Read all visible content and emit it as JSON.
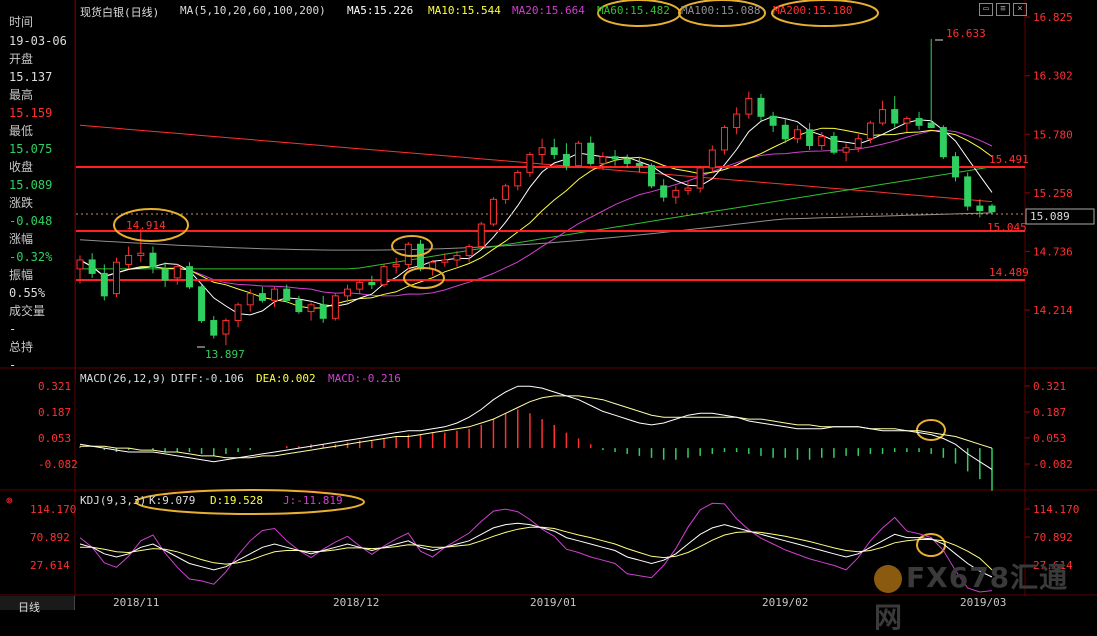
{
  "sidebar": {
    "time_label": "时间",
    "time_value": "19-03-06",
    "open_label": "开盘",
    "open_value": "15.137",
    "high_label": "最高",
    "high_value": "15.159",
    "low_label": "最低",
    "low_value": "15.075",
    "close_label": "收盘",
    "close_value": "15.089",
    "change_label": "涨跌",
    "change_value": "-0.048",
    "pct_label": "涨幅",
    "pct_value": "-0.32%",
    "amp_label": "振幅",
    "amp_value": "0.55%",
    "vol_label": "成交量",
    "vol_value": "-",
    "oi_label": "总持",
    "oi_value": "-"
  },
  "header": {
    "title": "现货白银(日线)",
    "ma_params": "MA(5,10,20,60,100,200)",
    "ma5": "MA5:15.226",
    "ma10": "MA10:15.544",
    "ma20": "MA20:15.664",
    "ma60": "MA60:15.482",
    "ma100": "MA100:15.088",
    "ma200": "MA200:15.180"
  },
  "macd_header": {
    "params": "MACD(26,12,9)",
    "diff": "DIFF:-0.106",
    "dea": "DEA:0.002",
    "macd": "MACD:-0.216"
  },
  "kdj_header": {
    "params": "KDJ(9,3,3)",
    "k": "K:9.079",
    "d": "D:19.528",
    "j": "J:-11.819"
  },
  "footer": {
    "period_tab": "日线",
    "dates": [
      "2018/11",
      "2018/12",
      "2019/01",
      "2019/02",
      "2019/03"
    ]
  },
  "watermark": "FX678汇通网",
  "colors": {
    "up": "#ff3030",
    "down": "#30d060",
    "ma5": "#ffffff",
    "ma10": "#ffff40",
    "ma20": "#d040d0",
    "ma60": "#30c030",
    "ma100": "#909090",
    "ma200": "#ff3030",
    "hline": "#ff2020",
    "circle": "#e8b030"
  },
  "chart_data": {
    "type": "candlestick",
    "price_axis": {
      "ticks": [
        "16.825",
        "16.302",
        "15.780",
        "15.258",
        "14.736",
        "14.214"
      ]
    },
    "current_price": "15.089",
    "annotations": {
      "high": "16.633",
      "low": "13.897",
      "levels": [
        "15.491",
        "14.914",
        "15.045",
        "14.489"
      ]
    },
    "candles": [
      {
        "o": 14.58,
        "h": 14.7,
        "l": 14.45,
        "c": 14.66
      },
      {
        "o": 14.66,
        "h": 14.72,
        "l": 14.5,
        "c": 14.54
      },
      {
        "o": 14.54,
        "h": 14.62,
        "l": 14.3,
        "c": 14.34
      },
      {
        "o": 14.36,
        "h": 14.68,
        "l": 14.33,
        "c": 14.64
      },
      {
        "o": 14.62,
        "h": 14.78,
        "l": 14.58,
        "c": 14.7
      },
      {
        "o": 14.7,
        "h": 14.94,
        "l": 14.64,
        "c": 14.72
      },
      {
        "o": 14.72,
        "h": 14.78,
        "l": 14.54,
        "c": 14.6
      },
      {
        "o": 14.58,
        "h": 14.64,
        "l": 14.42,
        "c": 14.48
      },
      {
        "o": 14.5,
        "h": 14.62,
        "l": 14.44,
        "c": 14.6
      },
      {
        "o": 14.6,
        "h": 14.64,
        "l": 14.4,
        "c": 14.42
      },
      {
        "o": 14.42,
        "h": 14.44,
        "l": 14.1,
        "c": 14.12
      },
      {
        "o": 14.12,
        "h": 14.16,
        "l": 13.96,
        "c": 13.99
      },
      {
        "o": 14.0,
        "h": 14.14,
        "l": 13.9,
        "c": 14.12
      },
      {
        "o": 14.12,
        "h": 14.28,
        "l": 14.06,
        "c": 14.26
      },
      {
        "o": 14.26,
        "h": 14.4,
        "l": 14.2,
        "c": 14.36
      },
      {
        "o": 14.36,
        "h": 14.42,
        "l": 14.28,
        "c": 14.3
      },
      {
        "o": 14.3,
        "h": 14.42,
        "l": 14.24,
        "c": 14.4
      },
      {
        "o": 14.4,
        "h": 14.44,
        "l": 14.28,
        "c": 14.3
      },
      {
        "o": 14.3,
        "h": 14.34,
        "l": 14.18,
        "c": 14.2
      },
      {
        "o": 14.2,
        "h": 14.28,
        "l": 14.12,
        "c": 14.26
      },
      {
        "o": 14.26,
        "h": 14.34,
        "l": 14.1,
        "c": 14.14
      },
      {
        "o": 14.14,
        "h": 14.36,
        "l": 14.12,
        "c": 14.34
      },
      {
        "o": 14.34,
        "h": 14.44,
        "l": 14.28,
        "c": 14.4
      },
      {
        "o": 14.4,
        "h": 14.48,
        "l": 14.36,
        "c": 14.46
      },
      {
        "o": 14.46,
        "h": 14.52,
        "l": 14.4,
        "c": 14.44
      },
      {
        "o": 14.44,
        "h": 14.62,
        "l": 14.42,
        "c": 14.6
      },
      {
        "o": 14.6,
        "h": 14.68,
        "l": 14.54,
        "c": 14.62
      },
      {
        "o": 14.62,
        "h": 14.82,
        "l": 14.58,
        "c": 14.8
      },
      {
        "o": 14.8,
        "h": 14.84,
        "l": 14.56,
        "c": 14.58
      },
      {
        "o": 14.58,
        "h": 14.66,
        "l": 14.52,
        "c": 14.64
      },
      {
        "o": 14.64,
        "h": 14.72,
        "l": 14.6,
        "c": 14.66
      },
      {
        "o": 14.66,
        "h": 14.74,
        "l": 14.6,
        "c": 14.7
      },
      {
        "o": 14.7,
        "h": 14.8,
        "l": 14.64,
        "c": 14.78
      },
      {
        "o": 14.78,
        "h": 15.0,
        "l": 14.76,
        "c": 14.98
      },
      {
        "o": 14.98,
        "h": 15.22,
        "l": 14.96,
        "c": 15.2
      },
      {
        "o": 15.2,
        "h": 15.34,
        "l": 15.16,
        "c": 15.32
      },
      {
        "o": 15.32,
        "h": 15.46,
        "l": 15.28,
        "c": 15.44
      },
      {
        "o": 15.44,
        "h": 15.62,
        "l": 15.4,
        "c": 15.6
      },
      {
        "o": 15.6,
        "h": 15.74,
        "l": 15.52,
        "c": 15.66
      },
      {
        "o": 15.66,
        "h": 15.74,
        "l": 15.56,
        "c": 15.6
      },
      {
        "o": 15.6,
        "h": 15.7,
        "l": 15.46,
        "c": 15.5
      },
      {
        "o": 15.5,
        "h": 15.72,
        "l": 15.48,
        "c": 15.7
      },
      {
        "o": 15.7,
        "h": 15.76,
        "l": 15.5,
        "c": 15.52
      },
      {
        "o": 15.52,
        "h": 15.62,
        "l": 15.46,
        "c": 15.58
      },
      {
        "o": 15.58,
        "h": 15.64,
        "l": 15.5,
        "c": 15.56
      },
      {
        "o": 15.56,
        "h": 15.6,
        "l": 15.48,
        "c": 15.52
      },
      {
        "o": 15.52,
        "h": 15.58,
        "l": 15.44,
        "c": 15.5
      },
      {
        "o": 15.5,
        "h": 15.52,
        "l": 15.3,
        "c": 15.32
      },
      {
        "o": 15.32,
        "h": 15.38,
        "l": 15.18,
        "c": 15.22
      },
      {
        "o": 15.22,
        "h": 15.32,
        "l": 15.16,
        "c": 15.28
      },
      {
        "o": 15.28,
        "h": 15.36,
        "l": 15.24,
        "c": 15.3
      },
      {
        "o": 15.3,
        "h": 15.5,
        "l": 15.26,
        "c": 15.48
      },
      {
        "o": 15.48,
        "h": 15.68,
        "l": 15.44,
        "c": 15.64
      },
      {
        "o": 15.64,
        "h": 15.86,
        "l": 15.6,
        "c": 15.84
      },
      {
        "o": 15.84,
        "h": 16.02,
        "l": 15.78,
        "c": 15.96
      },
      {
        "o": 15.96,
        "h": 16.16,
        "l": 15.92,
        "c": 16.1
      },
      {
        "o": 16.1,
        "h": 16.14,
        "l": 15.9,
        "c": 15.94
      },
      {
        "o": 15.94,
        "h": 15.98,
        "l": 15.8,
        "c": 15.86
      },
      {
        "o": 15.86,
        "h": 15.92,
        "l": 15.7,
        "c": 15.74
      },
      {
        "o": 15.74,
        "h": 15.86,
        "l": 15.7,
        "c": 15.82
      },
      {
        "o": 15.82,
        "h": 15.88,
        "l": 15.64,
        "c": 15.68
      },
      {
        "o": 15.68,
        "h": 15.8,
        "l": 15.64,
        "c": 15.76
      },
      {
        "o": 15.76,
        "h": 15.8,
        "l": 15.6,
        "c": 15.62
      },
      {
        "o": 15.62,
        "h": 15.7,
        "l": 15.54,
        "c": 15.66
      },
      {
        "o": 15.66,
        "h": 15.78,
        "l": 15.62,
        "c": 15.74
      },
      {
        "o": 15.74,
        "h": 15.9,
        "l": 15.7,
        "c": 15.88
      },
      {
        "o": 15.88,
        "h": 16.08,
        "l": 15.86,
        "c": 16.0
      },
      {
        "o": 16.0,
        "h": 16.12,
        "l": 15.84,
        "c": 15.88
      },
      {
        "o": 15.88,
        "h": 15.94,
        "l": 15.8,
        "c": 15.92
      },
      {
        "o": 15.92,
        "h": 15.98,
        "l": 15.82,
        "c": 15.86
      },
      {
        "o": 15.88,
        "h": 16.63,
        "l": 15.84,
        "c": 15.84
      },
      {
        "o": 15.84,
        "h": 15.86,
        "l": 15.56,
        "c": 15.58
      },
      {
        "o": 15.58,
        "h": 15.62,
        "l": 15.36,
        "c": 15.4
      },
      {
        "o": 15.4,
        "h": 15.44,
        "l": 15.1,
        "c": 15.14
      },
      {
        "o": 15.14,
        "h": 15.2,
        "l": 15.04,
        "c": 15.1
      },
      {
        "o": 15.14,
        "h": 15.16,
        "l": 15.07,
        "c": 15.09
      }
    ],
    "macd_axis": {
      "ticks": [
        "0.321",
        "0.187",
        "0.053",
        "-0.082"
      ]
    },
    "macd_hist": [
      0.01,
      0.0,
      -0.01,
      -0.02,
      -0.01,
      0.0,
      -0.01,
      -0.02,
      -0.02,
      -0.02,
      -0.03,
      -0.04,
      -0.03,
      -0.02,
      -0.01,
      0.0,
      0.0,
      0.01,
      0.01,
      0.02,
      0.02,
      0.02,
      0.03,
      0.04,
      0.04,
      0.05,
      0.06,
      0.07,
      0.07,
      0.08,
      0.08,
      0.09,
      0.1,
      0.12,
      0.15,
      0.18,
      0.2,
      0.18,
      0.15,
      0.12,
      0.08,
      0.05,
      0.02,
      -0.01,
      -0.02,
      -0.03,
      -0.04,
      -0.05,
      -0.06,
      -0.06,
      -0.05,
      -0.04,
      -0.03,
      -0.02,
      -0.02,
      -0.03,
      -0.04,
      -0.05,
      -0.05,
      -0.06,
      -0.06,
      -0.05,
      -0.05,
      -0.04,
      -0.04,
      -0.03,
      -0.03,
      -0.02,
      -0.02,
      -0.02,
      -0.03,
      -0.05,
      -0.08,
      -0.12,
      -0.16,
      -0.22
    ],
    "macd_diff": [
      0.02,
      0.01,
      0.0,
      -0.01,
      -0.02,
      -0.02,
      -0.02,
      -0.03,
      -0.04,
      -0.05,
      -0.06,
      -0.07,
      -0.06,
      -0.05,
      -0.04,
      -0.03,
      -0.02,
      -0.01,
      0.0,
      0.01,
      0.02,
      0.03,
      0.04,
      0.05,
      0.06,
      0.07,
      0.08,
      0.09,
      0.09,
      0.1,
      0.11,
      0.13,
      0.16,
      0.2,
      0.25,
      0.29,
      0.32,
      0.32,
      0.31,
      0.29,
      0.27,
      0.25,
      0.22,
      0.19,
      0.17,
      0.15,
      0.13,
      0.12,
      0.13,
      0.15,
      0.17,
      0.18,
      0.18,
      0.17,
      0.16,
      0.14,
      0.13,
      0.12,
      0.11,
      0.1,
      0.1,
      0.1,
      0.11,
      0.11,
      0.11,
      0.1,
      0.09,
      0.09,
      0.09,
      0.08,
      0.07,
      0.05,
      0.02,
      -0.03,
      -0.07,
      -0.11
    ],
    "macd_dea": [
      0.01,
      0.01,
      0.01,
      0.0,
      0.0,
      -0.01,
      -0.01,
      -0.02,
      -0.02,
      -0.03,
      -0.04,
      -0.04,
      -0.05,
      -0.05,
      -0.05,
      -0.04,
      -0.04,
      -0.03,
      -0.02,
      -0.01,
      0.0,
      0.01,
      0.02,
      0.03,
      0.04,
      0.05,
      0.06,
      0.06,
      0.07,
      0.08,
      0.09,
      0.1,
      0.11,
      0.13,
      0.15,
      0.18,
      0.21,
      0.24,
      0.26,
      0.27,
      0.27,
      0.27,
      0.26,
      0.25,
      0.23,
      0.21,
      0.19,
      0.17,
      0.16,
      0.16,
      0.16,
      0.16,
      0.16,
      0.16,
      0.16,
      0.15,
      0.15,
      0.14,
      0.13,
      0.12,
      0.12,
      0.11,
      0.11,
      0.11,
      0.11,
      0.1,
      0.1,
      0.1,
      0.09,
      0.09,
      0.08,
      0.07,
      0.06,
      0.04,
      0.02,
      0.0
    ],
    "kdj_axis": {
      "ticks": [
        "114.170",
        "70.892",
        "27.614"
      ]
    },
    "kdj_k": [
      60,
      55,
      45,
      40,
      45,
      55,
      60,
      50,
      40,
      30,
      25,
      20,
      25,
      35,
      45,
      55,
      60,
      55,
      50,
      45,
      50,
      55,
      60,
      55,
      50,
      55,
      60,
      65,
      55,
      50,
      55,
      60,
      65,
      75,
      85,
      90,
      92,
      90,
      85,
      80,
      70,
      65,
      60,
      55,
      50,
      40,
      35,
      30,
      35,
      45,
      60,
      75,
      85,
      90,
      85,
      80,
      75,
      70,
      65,
      60,
      55,
      50,
      45,
      40,
      45,
      55,
      65,
      75,
      70,
      70,
      68,
      60,
      45,
      30,
      18,
      9
    ],
    "kdj_d": [
      55,
      55,
      52,
      48,
      47,
      50,
      53,
      52,
      48,
      42,
      36,
      31,
      29,
      31,
      35,
      42,
      48,
      50,
      50,
      48,
      49,
      51,
      54,
      54,
      53,
      54,
      56,
      59,
      58,
      55,
      55,
      57,
      59,
      65,
      72,
      78,
      83,
      86,
      86,
      84,
      79,
      74,
      70,
      65,
      60,
      53,
      47,
      41,
      39,
      41,
      47,
      56,
      66,
      74,
      78,
      79,
      78,
      75,
      72,
      68,
      64,
      59,
      54,
      50,
      48,
      50,
      55,
      62,
      65,
      67,
      67,
      65,
      58,
      49,
      38,
      20
    ],
    "kdj_j": [
      70,
      55,
      31,
      24,
      41,
      65,
      74,
      46,
      24,
      6,
      3,
      -2,
      17,
      43,
      65,
      81,
      84,
      65,
      50,
      39,
      52,
      63,
      72,
      57,
      44,
      57,
      68,
      77,
      49,
      40,
      55,
      66,
      77,
      95,
      111,
      114,
      110,
      98,
      83,
      72,
      52,
      47,
      40,
      35,
      30,
      14,
      11,
      8,
      27,
      53,
      86,
      113,
      123,
      122,
      99,
      82,
      69,
      60,
      51,
      44,
      37,
      32,
      27,
      20,
      39,
      65,
      85,
      101,
      80,
      76,
      70,
      50,
      19,
      -8,
      -22,
      -12
    ]
  }
}
